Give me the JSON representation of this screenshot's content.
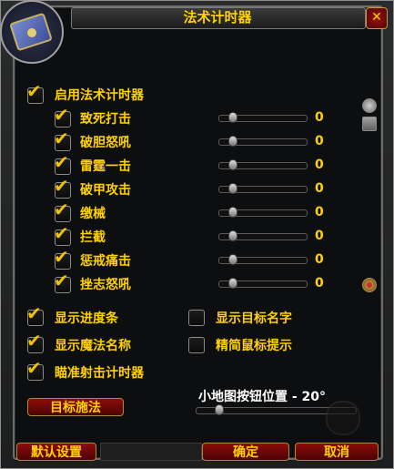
{
  "window": {
    "title": "法术计时器",
    "close_label": "✕"
  },
  "main_toggle": {
    "label": "启用法术计时器",
    "checked": true
  },
  "spells": [
    {
      "label": "致死打击",
      "checked": true,
      "value": "0"
    },
    {
      "label": "破胆怒吼",
      "checked": true,
      "value": "0"
    },
    {
      "label": "雷霆一击",
      "checked": true,
      "value": "0"
    },
    {
      "label": "破甲攻击",
      "checked": true,
      "value": "0"
    },
    {
      "label": "缴械",
      "checked": true,
      "value": "0"
    },
    {
      "label": "拦截",
      "checked": true,
      "value": "0"
    },
    {
      "label": "惩戒痛击",
      "checked": true,
      "value": "0"
    },
    {
      "label": "挫志怒吼",
      "checked": true,
      "value": "0"
    }
  ],
  "options": {
    "show_progress": {
      "label": "显示进度条",
      "checked": true
    },
    "show_spell_name": {
      "label": "显示魔法名称",
      "checked": true
    },
    "aim_timer": {
      "label": "瞄准射击计时器",
      "checked": true
    },
    "show_target_name": {
      "label": "显示目标名字",
      "checked": false
    },
    "simple_tooltip": {
      "label": "精简鼠标提示",
      "checked": false
    }
  },
  "target_cast_button": {
    "label": "目标施法"
  },
  "minimap": {
    "label": "小地图按钮位置 - 20°"
  },
  "footer": {
    "reset_label": "默认设置",
    "ok_label": "确定",
    "cancel_label": "取消"
  },
  "check_glyph": "✔",
  "colors": {
    "gold": "#ffd100",
    "button_red": "#8f0b0b"
  }
}
